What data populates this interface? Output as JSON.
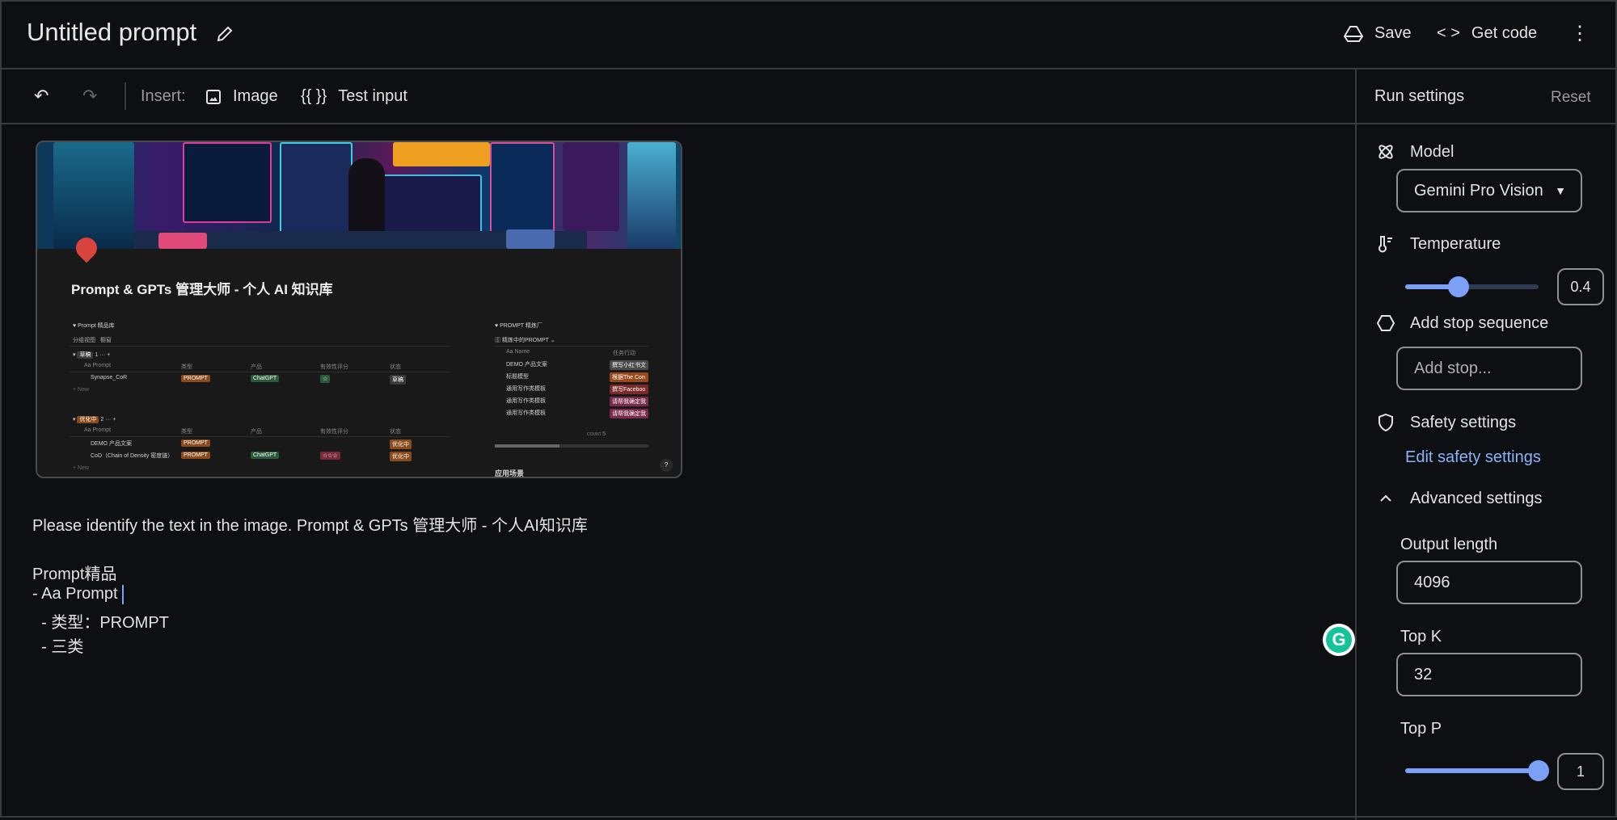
{
  "header": {
    "title": "Untitled prompt",
    "save_label": "Save",
    "get_code_label": "Get code"
  },
  "toolbar": {
    "insert_label": "Insert:",
    "image_label": "Image",
    "test_input_icon": "{{ }}",
    "test_input_label": "Test input"
  },
  "prompt": {
    "lines": [
      "Please identify the text in the image. Prompt & GPTs 管理大师 - 个人AI知识库",
      "",
      "Prompt精品",
      "- Aa Prompt",
      "  - 类型：PROMPT",
      "  - 三类"
    ]
  },
  "image_content": {
    "title": "Prompt & GPTs 管理大师 - 个人 AI 知识库",
    "left_db": "Prompt 精品库",
    "left_tabs": [
      "分组视图",
      "橱窗"
    ],
    "group1": "草稿",
    "group1_count": "1",
    "group2": "优化中",
    "group2_count": "2",
    "cols": [
      "Aa Prompt",
      "类型",
      "产品",
      "有效性评分",
      "状态"
    ],
    "rows1": [
      [
        "Synapse_CoR",
        "PROMPT",
        "ChatGPT",
        "☆",
        "草稿"
      ]
    ],
    "rows2": [
      [
        "DEMO 产品文案",
        "PROMPT",
        "",
        "",
        "优化中"
      ],
      [
        "CoD（Chain of Density 密度链）",
        "PROMPT",
        "ChatGPT",
        "☆☆☆",
        "优化中"
      ]
    ],
    "new": "+ New",
    "right_db": "PROMPT 精炼厂",
    "right_view": "精炼中的PROMPT",
    "right_cols": [
      "Aa Name",
      "任务行动"
    ],
    "right_rows": [
      [
        "DEMO 产品文案",
        "撰写小红书文"
      ],
      [
        "标题模型",
        "根据The Con"
      ],
      [
        "通用写作类模板",
        "撰写Faceboo"
      ],
      [
        "通用写作类模板",
        "请帮我确定我"
      ],
      [
        "通用写作类模板",
        "请帮我确定我"
      ]
    ],
    "count_label": "COUNT",
    "count": "5",
    "footer": "应用场景",
    "help": "?"
  },
  "run_settings": {
    "title": "Run settings",
    "reset": "Reset",
    "model_label": "Model",
    "model_value": "Gemini Pro Vision",
    "temperature_label": "Temperature",
    "temperature": "0.4",
    "temperature_fraction": 0.4,
    "stop_label": "Add stop sequence",
    "stop_placeholder": "Add stop...",
    "safety_label": "Safety settings",
    "safety_link": "Edit safety settings",
    "advanced_label": "Advanced settings",
    "output_length_label": "Output length",
    "output_length": "4096",
    "top_k_label": "Top K",
    "top_k": "32",
    "top_p_label": "Top P",
    "top_p": "1",
    "top_p_fraction": 1.0
  },
  "colors": {
    "accent": "#7ba0f5",
    "link": "#8ab4f8",
    "background": "#0e0f13",
    "grammarly": "#15c39a"
  }
}
